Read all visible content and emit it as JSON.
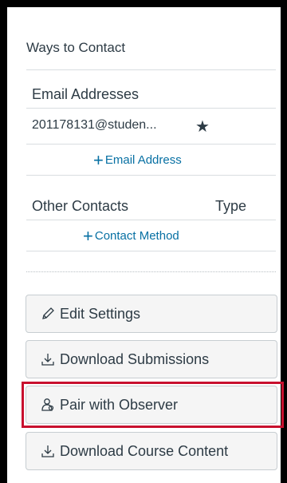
{
  "title": "Ways to Contact",
  "email_section": {
    "heading": "Email Addresses",
    "emails": [
      "201178131@studen..."
    ],
    "star_icon": "star-icon",
    "add_label": "Email Address"
  },
  "other_section": {
    "heading": "Other Contacts",
    "type_heading": "Type",
    "add_label": "Contact Method"
  },
  "buttons": {
    "edit_settings": "Edit Settings",
    "download_submissions": "Download Submissions",
    "pair_with_observer": "Pair with Observer",
    "download_course_content": "Download Course Content"
  },
  "colors": {
    "link": "#0770a3",
    "highlight": "#c8102e",
    "text": "#2d3b45"
  }
}
